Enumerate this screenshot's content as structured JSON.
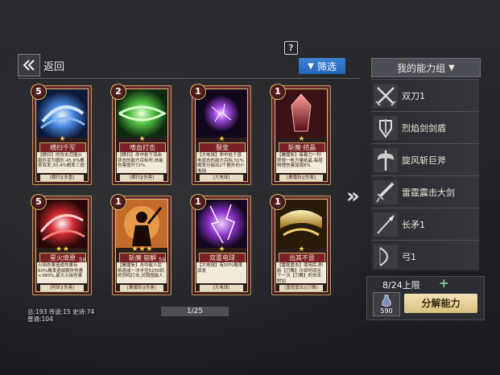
{
  "header": {
    "back_label": "返回",
    "filter_label": "筛选",
    "group_label": "我的能力组"
  },
  "cards": [
    {
      "cost": "5",
      "stars": "★",
      "name": "横扫千军",
      "desc": "【横扫】的攻击范围从扇形变为圆形,45.6%概率双发,30.4%概率三炮",
      "tag": "[横扫][多重]",
      "count": "",
      "art": "blue-swirl"
    },
    {
      "cost": "2",
      "stars": "★",
      "name": "嗜血打击",
      "desc": "【横扫】命中处于流血状态的敌方目标时,技能伤害提升72%",
      "tag": "[横扫][伤害]",
      "count": "",
      "art": "green-swirl"
    },
    {
      "cost": "1",
      "stars": "★",
      "name": "裂变",
      "desc": "【大电球】命中处于感电状态的敌方目标,51%概率分裂出2个额外的小电球",
      "tag": "[大电球]",
      "count": "",
      "art": "purple-orb"
    },
    {
      "cost": "1",
      "stars": "★",
      "name": "斩魔·结晶",
      "desc": "【屠魔斩】每着力一秒获得一枚力量结晶,每层物理伤害加成8%",
      "tag": "[屠魔斩][伤害]",
      "count": "",
      "art": "red-crystal"
    },
    {
      "cost": "5",
      "stars": "★ ★",
      "name": "星火燎原",
      "desc": "火焰伤害造成伤害有60%概率造成额外伤害+380%,最大火焰伤害",
      "tag": "[阿研][伤害]",
      "count": "58",
      "art": "red-swirl"
    },
    {
      "cost": "1",
      "stars": "★ ★ ★",
      "name": "斩魔·崩解",
      "desc": "【屠魔斩】击中敌人后将造成一次半径5250码的剑鸣打击,对周围敌人",
      "tag": "[屠魔斩][伤害]",
      "count": "58",
      "art": "silhouette"
    },
    {
      "cost": "1",
      "stars": "★",
      "name": "双重电球",
      "desc": "【大电球】有50%概率双发",
      "tag": "[大电球]",
      "count": "",
      "art": "purple-lightning"
    },
    {
      "cost": "1",
      "stars": "★",
      "name": "出其不意",
      "desc": "【雷霆震击】使用后,刷新【刃舞】冷却时间且下一次【刃舞】的攻击附加",
      "tag": "[雷霆震击][刃舞]",
      "count": "",
      "art": "gold-slash"
    }
  ],
  "ability_group": [
    {
      "label": "双刀1",
      "icon": "dual-blade-icon"
    },
    {
      "label": "烈焰剑剑盾",
      "icon": "sword-shield-icon"
    },
    {
      "label": "旋风斩巨斧",
      "icon": "great-axe-icon"
    },
    {
      "label": "雷霆震击大剑",
      "icon": "great-sword-icon"
    },
    {
      "label": "长矛1",
      "icon": "spear-icon"
    },
    {
      "label": "弓1",
      "icon": "bow-icon"
    }
  ],
  "footer": {
    "stats_line1": "总:193 传说:15 史诗:74",
    "stats_line2": "普通:104",
    "page_indicator": "1/25",
    "limit_text": "8/24上限",
    "resource_count": "590",
    "decompose_label": "分解能力"
  }
}
